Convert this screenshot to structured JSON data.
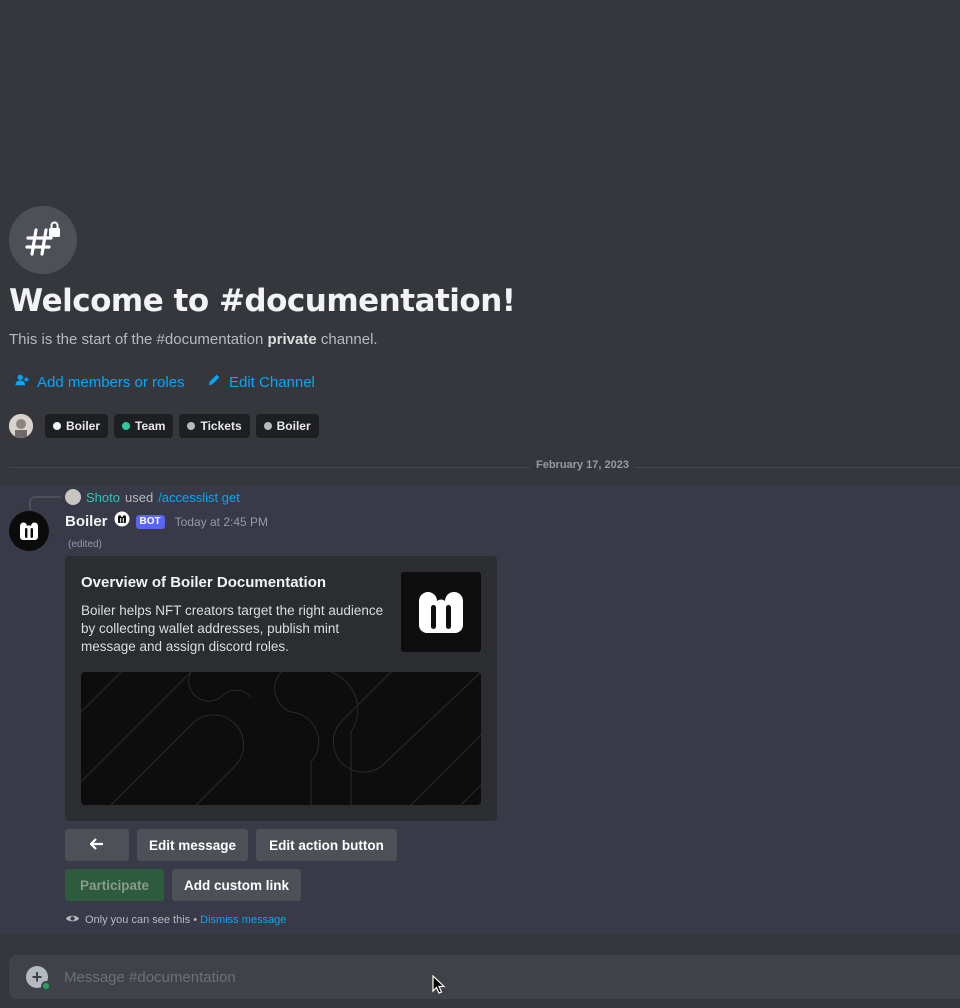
{
  "channel": {
    "welcome_title": "Welcome to #documentation!",
    "welcome_sub_prefix": "This is the start of the #documentation ",
    "welcome_sub_bold": "private",
    "welcome_sub_suffix": " channel.",
    "icon": "hashtag-lock-icon"
  },
  "actions": {
    "add_members": "Add members or roles",
    "edit_channel": "Edit Channel"
  },
  "roles": [
    {
      "label": "Boiler",
      "color": "#f2f3f5"
    },
    {
      "label": "Team",
      "color": "#2dc7a0"
    },
    {
      "label": "Tickets",
      "color": "#b5bac1"
    },
    {
      "label": "Boiler",
      "color": "#b5bac1"
    }
  ],
  "date_divider": "February 17, 2023",
  "reply": {
    "user": "Shoto",
    "used": "used",
    "command": "/accesslist get"
  },
  "message": {
    "author": "Boiler",
    "bot_tag": "BOT",
    "timestamp": "Today at 2:45 PM",
    "edited": "(edited)"
  },
  "embed": {
    "title": "Overview of Boiler Documentation",
    "description": "Boiler helps NFT creators target the right audience by collecting wallet addresses, publish mint message and assign discord roles."
  },
  "buttons": {
    "back": "←",
    "edit_message": "Edit message",
    "edit_action": "Edit action button",
    "participate": "Participate",
    "add_custom_link": "Add custom link"
  },
  "ephemeral": {
    "text": "Only you can see this • ",
    "dismiss": "Dismiss message"
  },
  "composer": {
    "placeholder": "Message #documentation"
  },
  "colors": {
    "accent": "#00a8fc",
    "bot_tag": "#5865f2",
    "success": "#23a55a"
  }
}
